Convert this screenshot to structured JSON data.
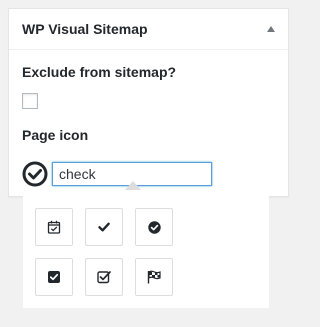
{
  "metabox": {
    "title": "WP Visual Sitemap"
  },
  "exclude": {
    "label": "Exclude from sitemap?",
    "checked": false
  },
  "page_icon": {
    "label": "Page icon",
    "preview_icon": "check-circle-icon",
    "search_value": "check"
  },
  "icon_picker": {
    "icons": [
      "calendar-check-icon",
      "check-icon",
      "check-circle-icon",
      "check-square-icon",
      "check-square-outline-icon",
      "flag-checkered-icon"
    ]
  },
  "colors": {
    "focus_border": "#5b9dd9",
    "icon_dark": "#23282d"
  }
}
